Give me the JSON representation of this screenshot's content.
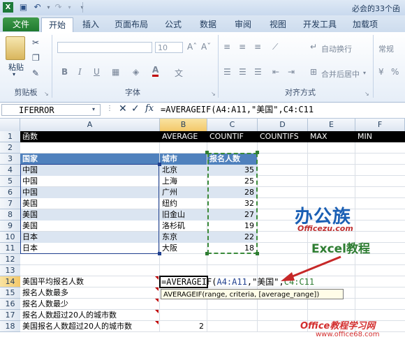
{
  "title_bar": {
    "title": "必会的33个函"
  },
  "tabs": [
    "文件",
    "开始",
    "插入",
    "页面布局",
    "公式",
    "数据",
    "审阅",
    "视图",
    "开发工具",
    "加载项"
  ],
  "ribbon": {
    "paste_label": "粘贴",
    "clipboard_label": "剪贴板",
    "font_label": "字体",
    "font_size": "10",
    "align_label": "对齐方式",
    "wrap_label": "自动换行",
    "merge_label": "合并后居中",
    "number_label": "常规",
    "bold": "B",
    "italic": "I",
    "underline": "U",
    "grow_font": "Aˆ",
    "shrink_font": "Aˇ"
  },
  "formula_bar": {
    "name_box": "IFERROR",
    "fx": "fx",
    "formula": "=AVERAGEIF(A4:A11,\"美国\",C4:C11"
  },
  "columns": [
    "A",
    "B",
    "C",
    "D",
    "E",
    "F"
  ],
  "rows": [
    "1",
    "2",
    "3",
    "4",
    "5",
    "6",
    "7",
    "8",
    "9",
    "10",
    "11",
    "12",
    "13",
    "14",
    "15",
    "16",
    "17",
    "18"
  ],
  "row1": [
    "函数",
    "AVERAGE",
    "COUNTIF",
    "COUNTIFS",
    "MAX",
    "MIN"
  ],
  "table_header": [
    "国家",
    "城市",
    "报名人数"
  ],
  "table_rows": [
    {
      "country": "中国",
      "city": "北京",
      "count": "35"
    },
    {
      "country": "中国",
      "city": "上海",
      "count": "25"
    },
    {
      "country": "中国",
      "city": "广州",
      "count": "28"
    },
    {
      "country": "美国",
      "city": "纽约",
      "count": "32"
    },
    {
      "country": "美国",
      "city": "旧金山",
      "count": "27"
    },
    {
      "country": "美国",
      "city": "洛杉矶",
      "count": "19"
    },
    {
      "country": "日本",
      "city": "东京",
      "count": "22"
    },
    {
      "country": "日本",
      "city": "大阪",
      "count": "18"
    }
  ],
  "questions": [
    "美国平均报名人数",
    "报名人数最多",
    "报名人数最少",
    "报名人数超过20人的城市数",
    "美国报名人数超过20人的城市数"
  ],
  "edit_cell": {
    "part1": "=AVERAGEIF(",
    "part2": "A4:A11",
    "part3": ",\"美国\",",
    "part4": "C4:C11"
  },
  "b18_value": "2",
  "tooltip": "AVERAGEIF(range, criteria, [average_range])",
  "watermark": {
    "logo": "办公族",
    "site": "Officezu.com",
    "excel_title": "Excel教程",
    "footer": "Office教程学习网",
    "footer_url": "www.office68.com"
  }
}
